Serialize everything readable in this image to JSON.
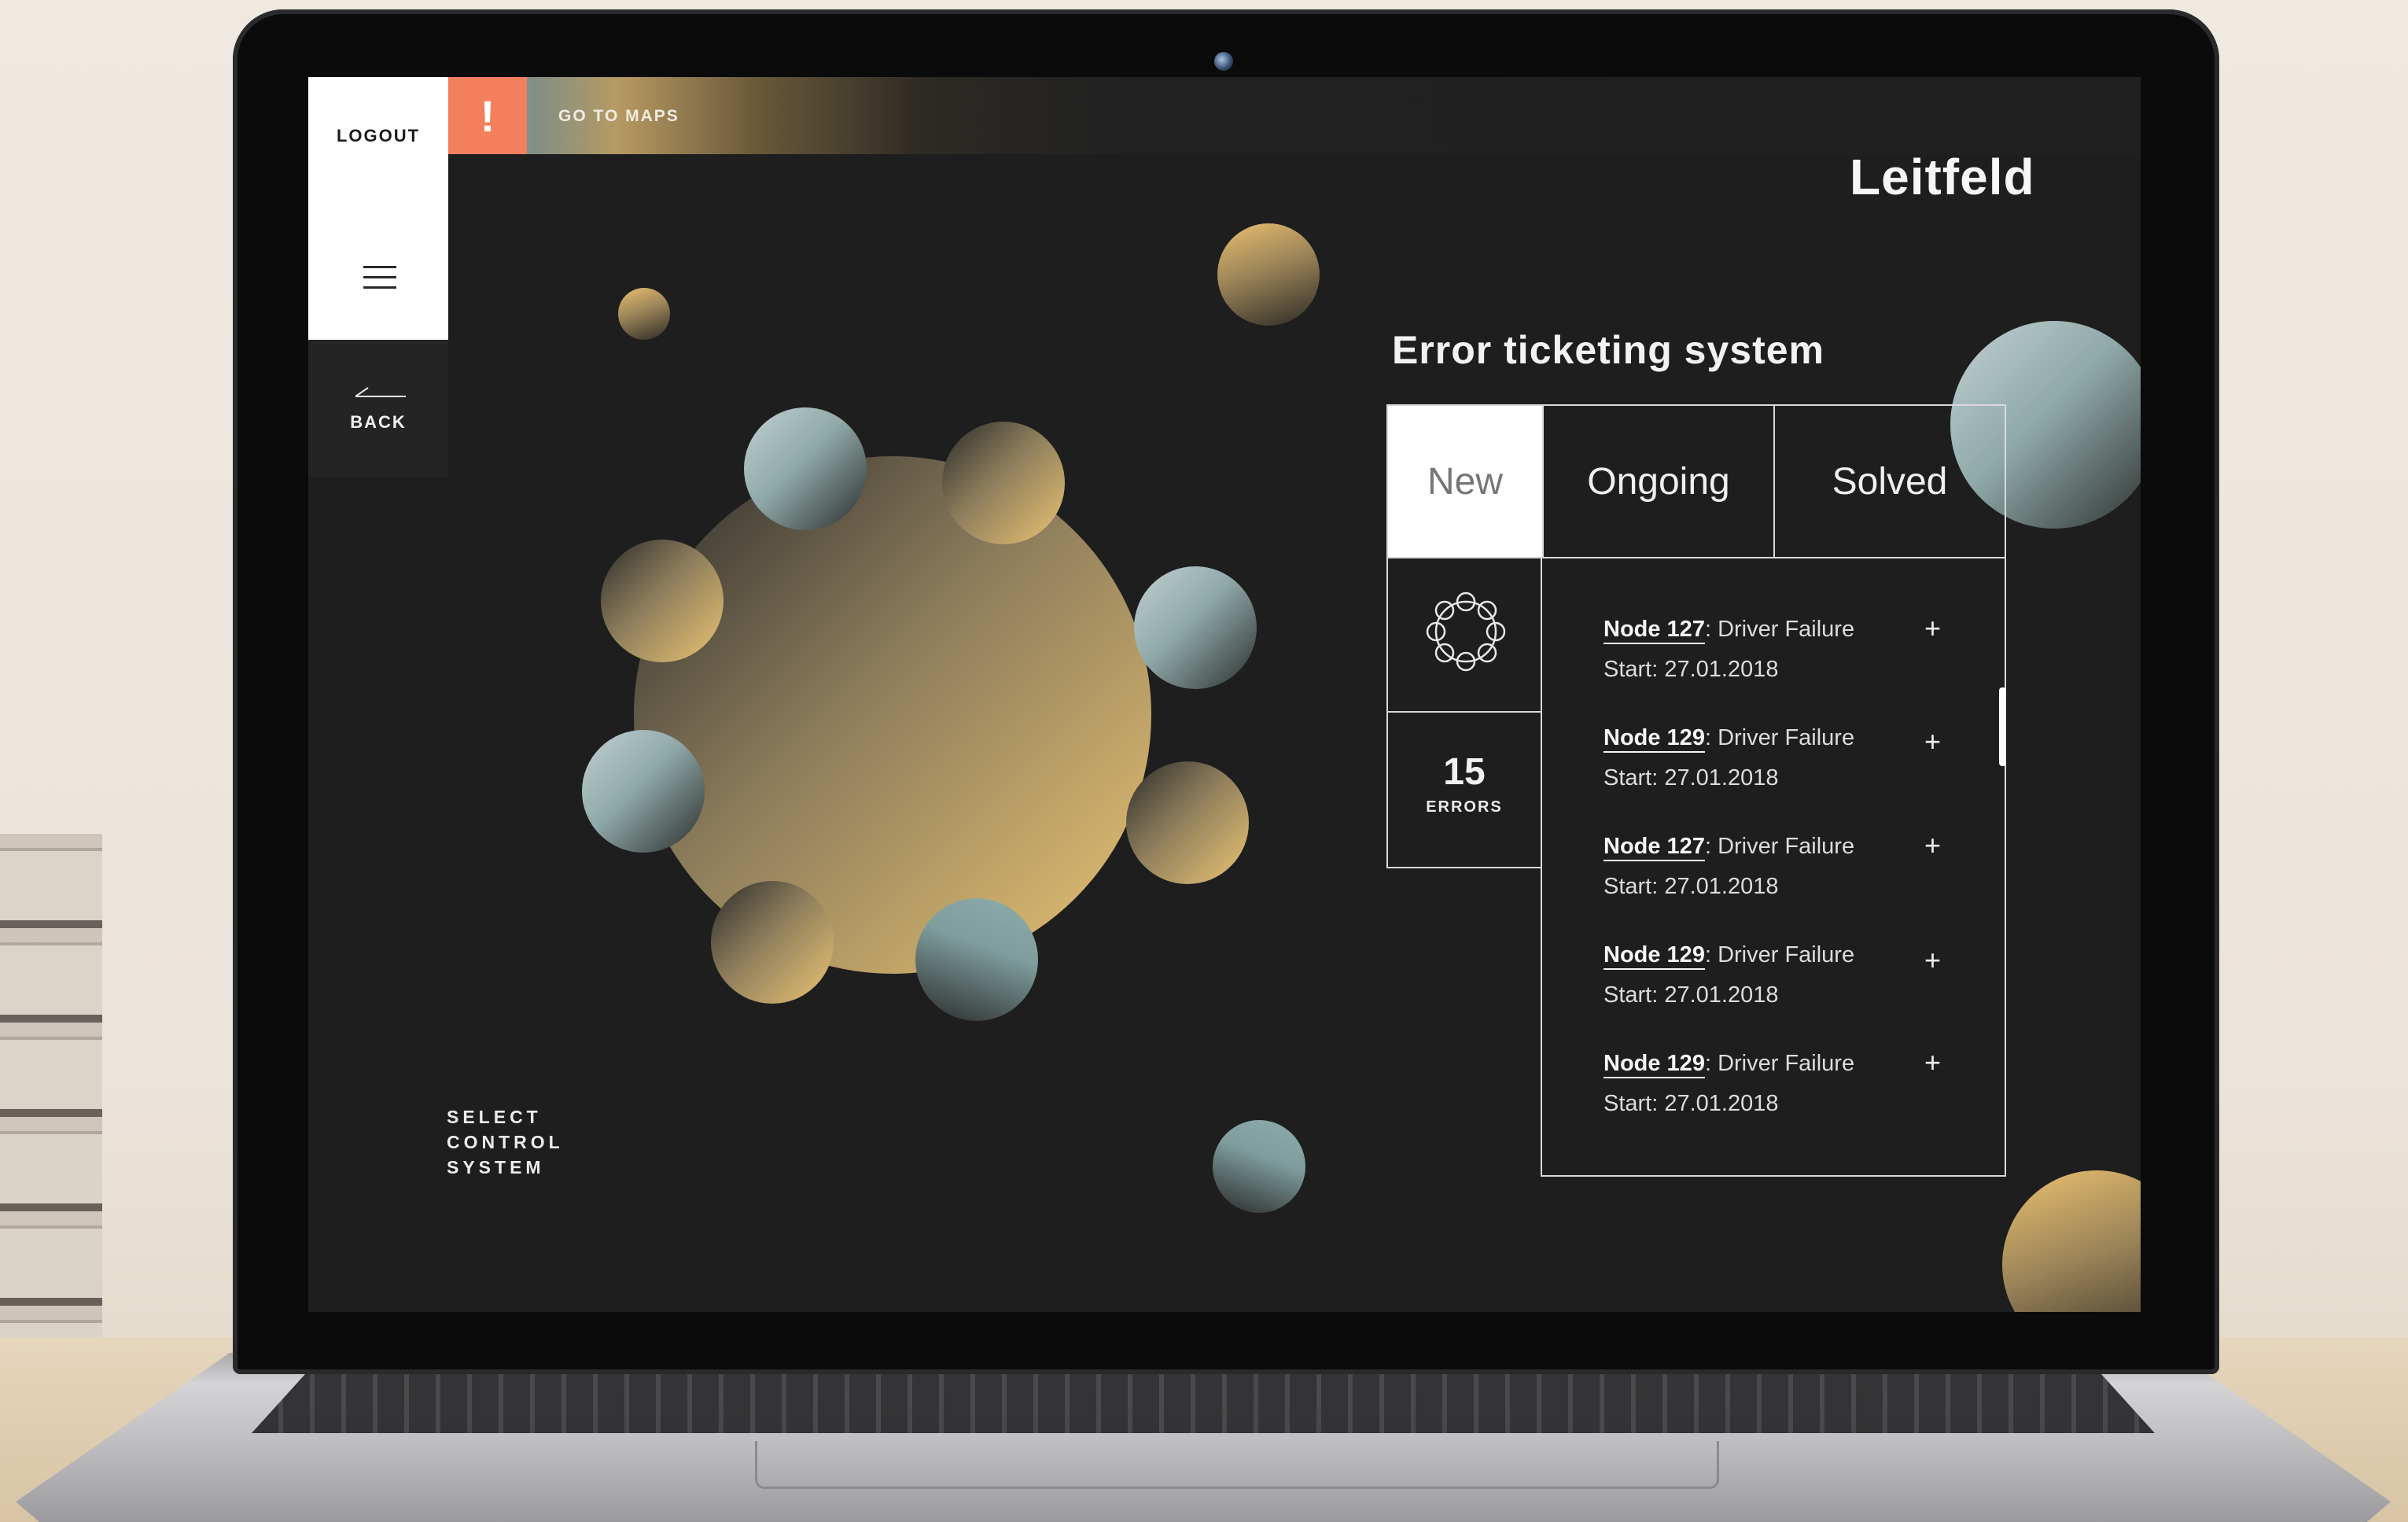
{
  "topbar": {
    "go_to_maps": "GO TO MAPS",
    "alert_symbol": "!"
  },
  "sidebar": {
    "logout": "LOGOUT",
    "back": "BACK"
  },
  "brand": "Leitfeld",
  "footer": {
    "select_control_system": "SELECT\nCONTROL\nSYSTEM"
  },
  "panel": {
    "title": "Error ticketing system",
    "tabs": [
      {
        "label": "New",
        "active": true
      },
      {
        "label": "Ongoing",
        "active": false
      },
      {
        "label": "Solved",
        "active": false
      }
    ],
    "error_count": "15",
    "error_label": "ERRORS",
    "items": [
      {
        "node": "Node 127",
        "issue": ": Driver Failure",
        "start": "Start: 27.01.2018"
      },
      {
        "node": "Node 129",
        "issue": ": Driver Failure",
        "start": "Start: 27.01.2018"
      },
      {
        "node": "Node 127",
        "issue": ": Driver Failure",
        "start": "Start: 27.01.2018"
      },
      {
        "node": "Node 129",
        "issue": ": Driver Failure",
        "start": "Start: 27.01.2018"
      },
      {
        "node": "Node 129",
        "issue": ": Driver Failure",
        "start": "Start: 27.01.2018"
      }
    ],
    "item_action": "+"
  },
  "colors": {
    "accent_alert": "#f37f5d",
    "gold": "#e9c06f",
    "teal": "#9fbfbf",
    "screen_bg": "#1e1e1f"
  },
  "icons": {
    "menu": "hamburger-menu-icon",
    "back": "back-arrow-icon",
    "node_cluster": "node-ring-icon",
    "alert": "exclamation-icon"
  }
}
